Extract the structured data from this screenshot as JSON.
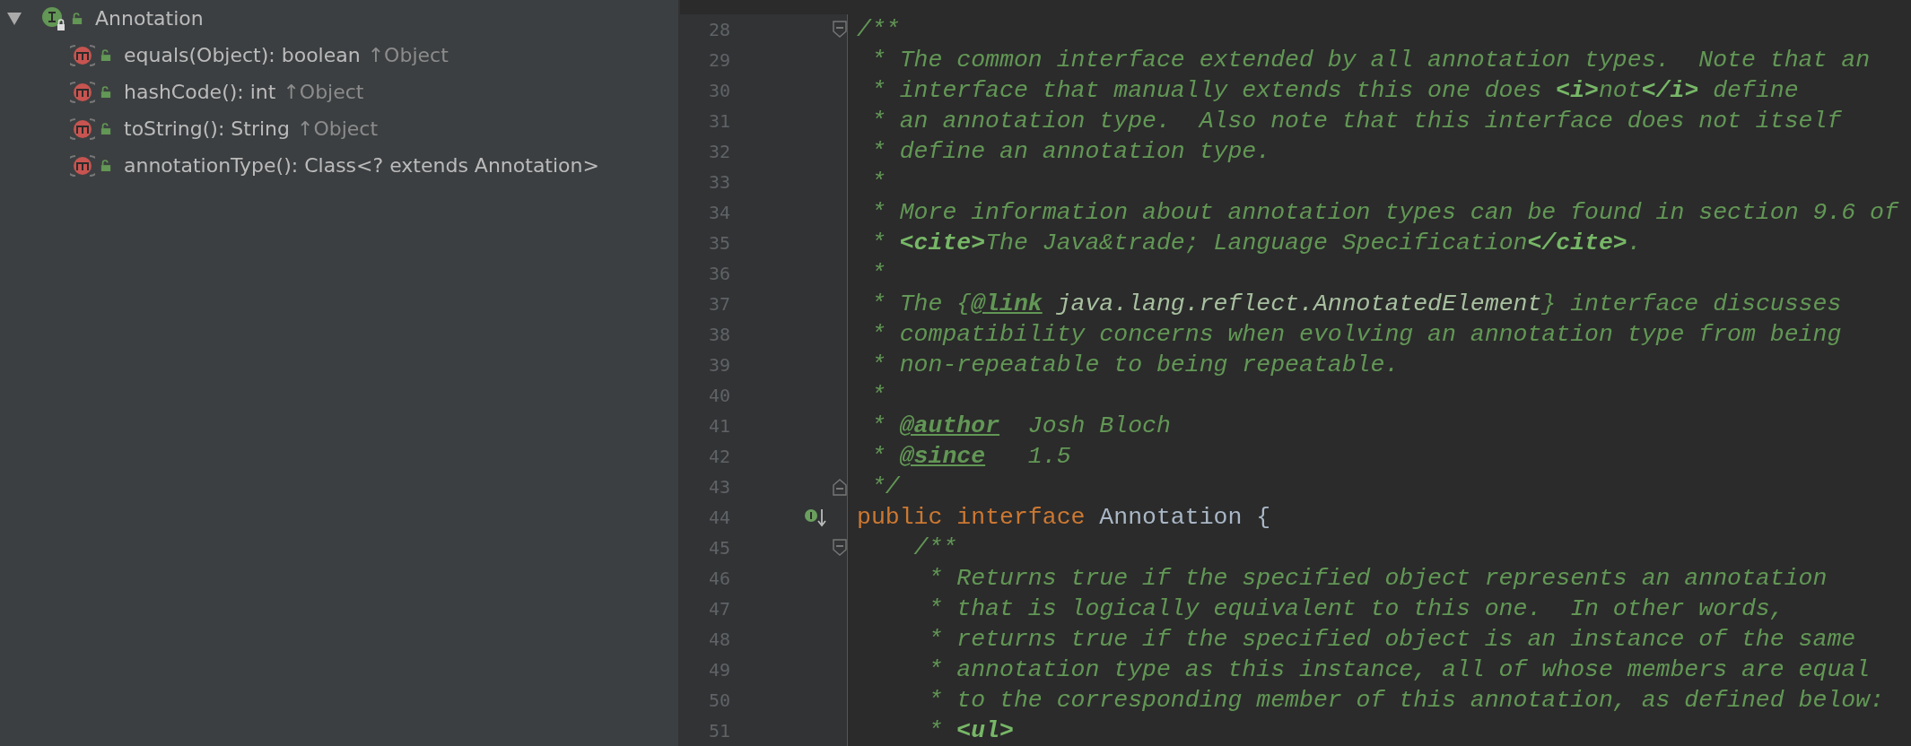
{
  "structure": {
    "root": {
      "kind": "interface",
      "label": "Annotation",
      "expanded": true,
      "children": [
        {
          "kind": "method",
          "label": "equals(Object): boolean",
          "origin": "↑Object"
        },
        {
          "kind": "method",
          "label": "hashCode(): int",
          "origin": "↑Object"
        },
        {
          "kind": "method",
          "label": "toString(): String",
          "origin": "↑Object"
        },
        {
          "kind": "method",
          "label": "annotationType(): Class<? extends Annotation>"
        }
      ]
    }
  },
  "editor": {
    "lines": [
      {
        "number": "28",
        "fold_start": true,
        "fold_end": false,
        "implemented": false,
        "segments": [
          {
            "kind": "comment",
            "text": "/**"
          }
        ]
      },
      {
        "number": "29",
        "fold_start": false,
        "fold_end": false,
        "implemented": false,
        "segments": [
          {
            "kind": "comment",
            "text": " * The common interface extended by all annotation types.  Note that an"
          }
        ]
      },
      {
        "number": "30",
        "fold_start": false,
        "fold_end": false,
        "implemented": false,
        "segments": [
          {
            "kind": "comment",
            "text": " * interface that manually extends this one does "
          },
          {
            "kind": "html",
            "text": "<i>"
          },
          {
            "kind": "comment",
            "text": "not"
          },
          {
            "kind": "html",
            "text": "</i>"
          },
          {
            "kind": "comment",
            "text": " define"
          }
        ]
      },
      {
        "number": "31",
        "fold_start": false,
        "fold_end": false,
        "implemented": false,
        "segments": [
          {
            "kind": "comment",
            "text": " * an annotation type.  Also note that this interface does not itself"
          }
        ]
      },
      {
        "number": "32",
        "fold_start": false,
        "fold_end": false,
        "implemented": false,
        "segments": [
          {
            "kind": "comment",
            "text": " * define an annotation type."
          }
        ]
      },
      {
        "number": "33",
        "fold_start": false,
        "fold_end": false,
        "implemented": false,
        "segments": [
          {
            "kind": "comment",
            "text": " *"
          }
        ]
      },
      {
        "number": "34",
        "fold_start": false,
        "fold_end": false,
        "implemented": false,
        "segments": [
          {
            "kind": "comment",
            "text": " * More information about annotation types can be found in section 9.6 of"
          }
        ]
      },
      {
        "number": "35",
        "fold_start": false,
        "fold_end": false,
        "implemented": false,
        "segments": [
          {
            "kind": "comment",
            "text": " * "
          },
          {
            "kind": "html",
            "text": "<cite>"
          },
          {
            "kind": "comment",
            "text": "The Java&trade; Language Specification"
          },
          {
            "kind": "html",
            "text": "</cite>"
          },
          {
            "kind": "comment",
            "text": "."
          }
        ]
      },
      {
        "number": "36",
        "fold_start": false,
        "fold_end": false,
        "implemented": false,
        "segments": [
          {
            "kind": "comment",
            "text": " *"
          }
        ]
      },
      {
        "number": "37",
        "fold_start": false,
        "fold_end": false,
        "implemented": false,
        "segments": [
          {
            "kind": "comment",
            "text": " * The {"
          },
          {
            "kind": "tag",
            "text": "@link"
          },
          {
            "kind": "ref",
            "text": " java.lang.reflect.AnnotatedElement"
          },
          {
            "kind": "comment",
            "text": "} interface discusses"
          }
        ]
      },
      {
        "number": "38",
        "fold_start": false,
        "fold_end": false,
        "implemented": false,
        "segments": [
          {
            "kind": "comment",
            "text": " * compatibility concerns when evolving an annotation type from being"
          }
        ]
      },
      {
        "number": "39",
        "fold_start": false,
        "fold_end": false,
        "implemented": false,
        "segments": [
          {
            "kind": "comment",
            "text": " * non-repeatable to being repeatable."
          }
        ]
      },
      {
        "number": "40",
        "fold_start": false,
        "fold_end": false,
        "implemented": false,
        "segments": [
          {
            "kind": "comment",
            "text": " *"
          }
        ]
      },
      {
        "number": "41",
        "fold_start": false,
        "fold_end": false,
        "implemented": false,
        "segments": [
          {
            "kind": "comment",
            "text": " * "
          },
          {
            "kind": "tag",
            "text": "@author"
          },
          {
            "kind": "comment",
            "text": "  Josh Bloch"
          }
        ]
      },
      {
        "number": "42",
        "fold_start": false,
        "fold_end": false,
        "implemented": false,
        "segments": [
          {
            "kind": "comment",
            "text": " * "
          },
          {
            "kind": "tag",
            "text": "@since"
          },
          {
            "kind": "comment",
            "text": "   1.5"
          }
        ]
      },
      {
        "number": "43",
        "fold_start": false,
        "fold_end": true,
        "implemented": false,
        "segments": [
          {
            "kind": "comment",
            "text": " */"
          }
        ]
      },
      {
        "number": "44",
        "fold_start": false,
        "fold_end": false,
        "implemented": true,
        "segments": [
          {
            "kind": "keyword",
            "text": "public "
          },
          {
            "kind": "keyword",
            "text": "interface"
          },
          {
            "kind": "plain",
            "text": " Annotation {"
          }
        ]
      },
      {
        "number": "45",
        "fold_start": true,
        "fold_end": false,
        "implemented": false,
        "segments": [
          {
            "kind": "comment",
            "text": "    /**"
          }
        ]
      },
      {
        "number": "46",
        "fold_start": false,
        "fold_end": false,
        "implemented": false,
        "segments": [
          {
            "kind": "comment",
            "text": "     * Returns true if the specified object represents an annotation"
          }
        ]
      },
      {
        "number": "47",
        "fold_start": false,
        "fold_end": false,
        "implemented": false,
        "segments": [
          {
            "kind": "comment",
            "text": "     * that is logically equivalent to this one.  In other words,"
          }
        ]
      },
      {
        "number": "48",
        "fold_start": false,
        "fold_end": false,
        "implemented": false,
        "segments": [
          {
            "kind": "comment",
            "text": "     * returns true if the specified object is an instance of the same"
          }
        ]
      },
      {
        "number": "49",
        "fold_start": false,
        "fold_end": false,
        "implemented": false,
        "segments": [
          {
            "kind": "comment",
            "text": "     * annotation type as this instance, all of whose members are equal"
          }
        ]
      },
      {
        "number": "50",
        "fold_start": false,
        "fold_end": false,
        "implemented": false,
        "segments": [
          {
            "kind": "comment",
            "text": "     * to the corresponding member of this annotation, as defined below:"
          }
        ]
      },
      {
        "number": "51",
        "fold_start": false,
        "fold_end": false,
        "implemented": false,
        "segments": [
          {
            "kind": "comment",
            "text": "     * "
          },
          {
            "kind": "html",
            "text": "<ul>"
          }
        ]
      }
    ]
  }
}
